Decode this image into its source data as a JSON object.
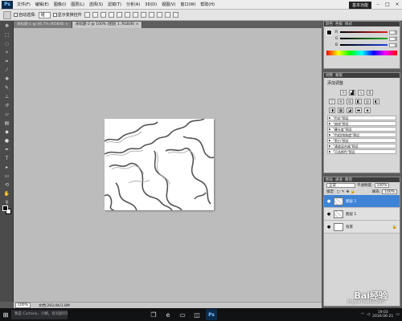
{
  "app": {
    "logo": "Ps"
  },
  "menubar": {
    "items": [
      "文件(F)",
      "编辑(E)",
      "图像(I)",
      "图层(L)",
      "选择(S)",
      "滤镜(T)",
      "分析(A)",
      "3D(D)",
      "视图(V)",
      "窗口(W)",
      "帮助(H)"
    ],
    "workspace": "基本功能",
    "minimize": "–",
    "maximize": "□",
    "close": "×"
  },
  "options": {
    "auto_select_label": "自动选择:",
    "auto_select_value": "组",
    "show_transform_label": "显示变换控件"
  },
  "tabs": [
    {
      "label": "未标题-1 @ 66.7% (RGB/8) ×"
    },
    {
      "label": "未标题-2 @ 100% (图层 1, RGB/8) ×"
    }
  ],
  "statusbar": {
    "zoom": "100%",
    "doc_info": "文档:293.0K/1.8M"
  },
  "color_panel": {
    "tabs": [
      "颜色",
      "色板",
      "样式"
    ],
    "sliders": [
      {
        "label": "R",
        "value": "0",
        "color": "#e02020"
      },
      {
        "label": "G",
        "value": "0",
        "color": "#20b020"
      },
      {
        "label": "B",
        "value": "0",
        "color": "#2040e0"
      }
    ]
  },
  "adjust_panel": {
    "tabs": [
      "调整",
      "蒙版"
    ],
    "title": "添加调整",
    "presets": [
      "\"色阶\"预设",
      "\"曲线\"预设",
      "\"曝光度\"预设",
      "\"色相/饱和度\"预设",
      "\"黑白\"预设",
      "\"通道混合器\"预设",
      "\"可选颜色\"预设"
    ]
  },
  "layers_panel": {
    "tabs": [
      "图层",
      "通道",
      "路径"
    ],
    "blend_mode": "正常",
    "opacity_label": "不透明度:",
    "opacity_value": "100%",
    "lock_label": "锁定:",
    "fill_label": "填充:",
    "fill_value": "100%",
    "layers": [
      {
        "name": "图层 2",
        "selected": true
      },
      {
        "name": "图层 1",
        "selected": false
      },
      {
        "name": "背景",
        "selected": false
      }
    ]
  },
  "taskbar": {
    "search_placeholder": "我是 Cortana，小娜。有问题尽管问我。",
    "time": "19:03",
    "date": "2016-06-21"
  },
  "watermark": {
    "text": "Bai经验",
    "url": "jingyan.baidu.com"
  }
}
